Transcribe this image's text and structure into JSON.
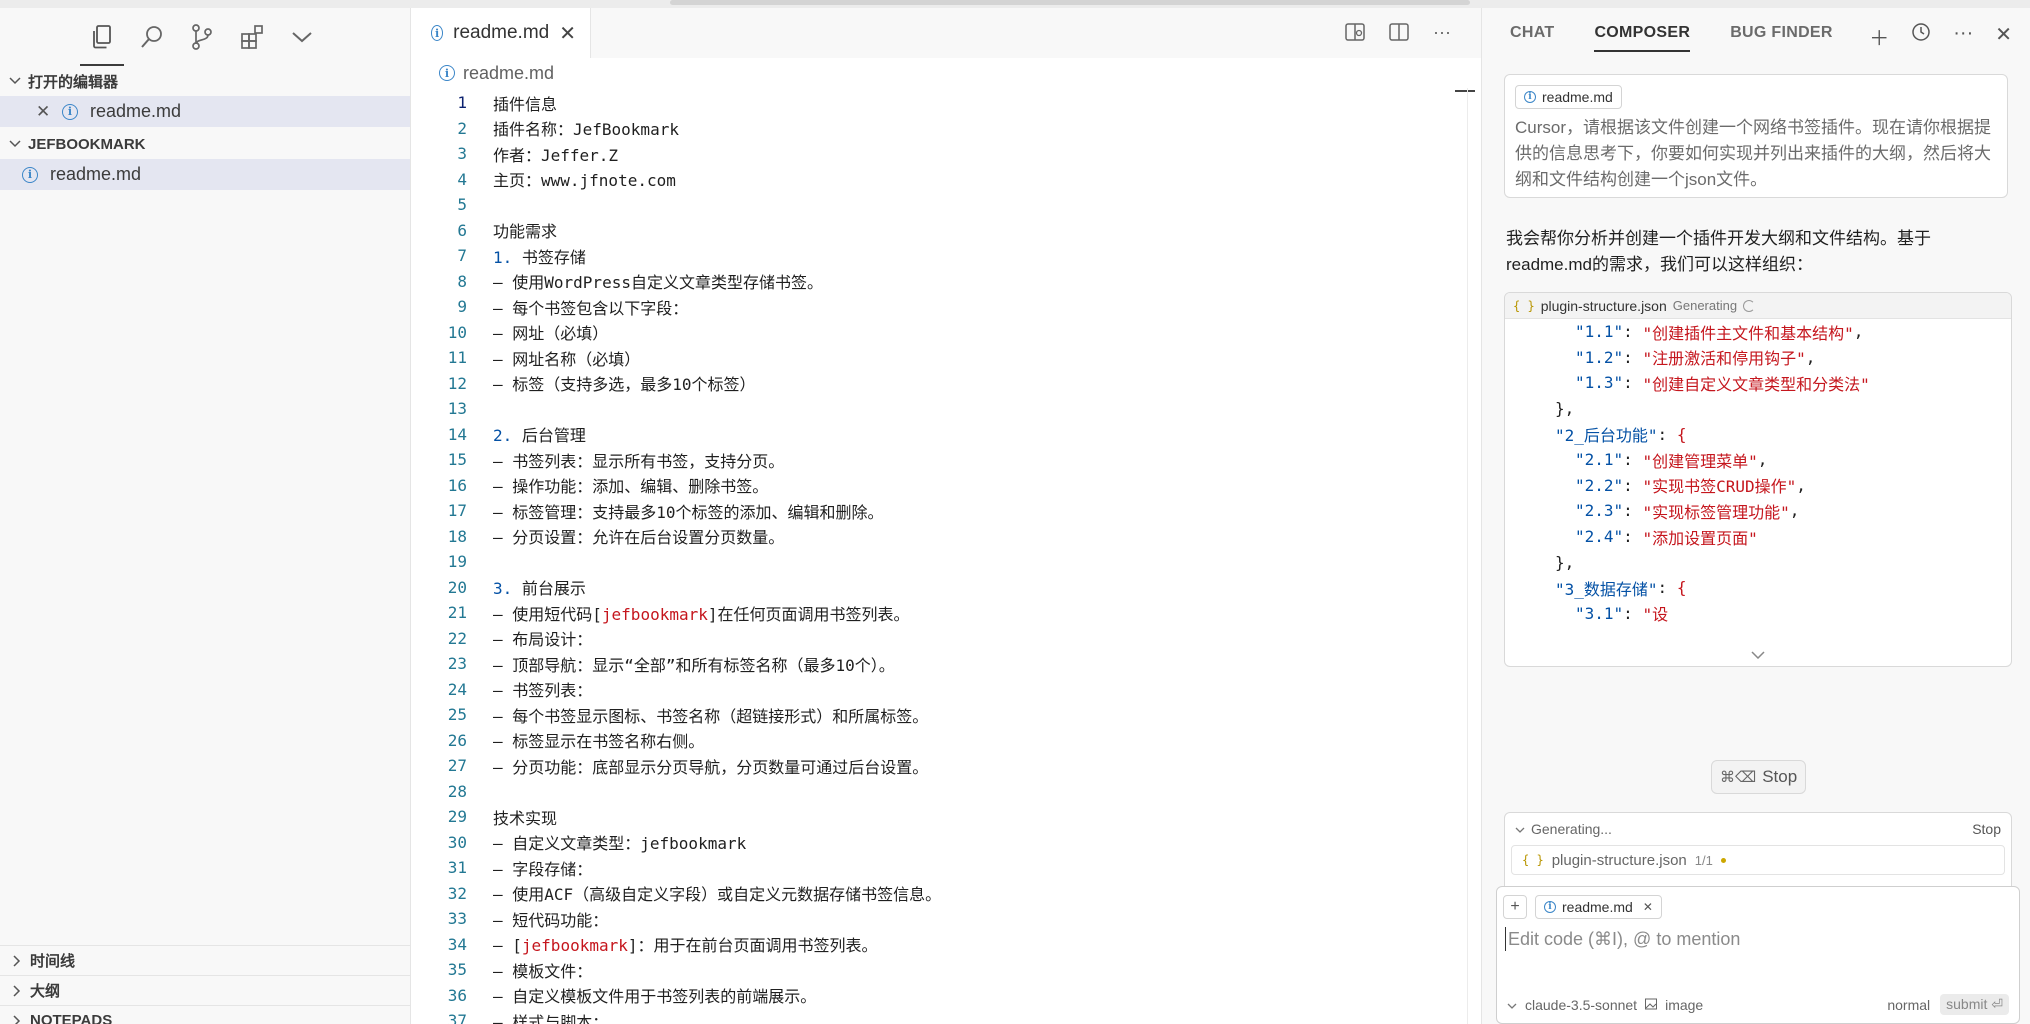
{
  "sidebar": {
    "open_editors_title": "打开的编辑器",
    "open_editor_file": "readme.md",
    "project_title": "JEFBOOKMARK",
    "project_file": "readme.md",
    "bottom_sections": [
      "时间线",
      "大纲",
      "NOTEPADS"
    ]
  },
  "editor": {
    "tab_label": "readme.md",
    "breadcrumb": "readme.md",
    "lines": [
      {
        "n": "1",
        "t": "插件信息"
      },
      {
        "n": "2",
        "t": "插件名称：JefBookmark"
      },
      {
        "n": "3",
        "t": "作者：Jeffer.Z"
      },
      {
        "n": "4",
        "t": "主页：www.jfnote.com"
      },
      {
        "n": "5",
        "t": ""
      },
      {
        "n": "6",
        "t": "功能需求"
      },
      {
        "n": "7",
        "p": "1.",
        "t": " 书签存储"
      },
      {
        "n": "8",
        "t": "– 使用WordPress自定义文章类型存储书签。"
      },
      {
        "n": "9",
        "t": "– 每个书签包含以下字段："
      },
      {
        "n": "10",
        "t": "– 网址（必填）"
      },
      {
        "n": "11",
        "t": "– 网址名称（必填）"
      },
      {
        "n": "12",
        "t": "– 标签（支持多选，最多10个标签）"
      },
      {
        "n": "13",
        "t": ""
      },
      {
        "n": "14",
        "p": "2.",
        "t": " 后台管理"
      },
      {
        "n": "15",
        "t": "– 书签列表：显示所有书签，支持分页。"
      },
      {
        "n": "16",
        "t": "– 操作功能：添加、编辑、删除书签。"
      },
      {
        "n": "17",
        "t": "– 标签管理：支持最多10个标签的添加、编辑和删除。"
      },
      {
        "n": "18",
        "t": "– 分页设置：允许在后台设置分页数量。"
      },
      {
        "n": "19",
        "t": ""
      },
      {
        "n": "20",
        "p": "3.",
        "t": " 前台展示"
      },
      {
        "n": "21",
        "t": "– 使用短代码[",
        "k": "jefbookmark",
        "t2": "]在任何页面调用书签列表。"
      },
      {
        "n": "22",
        "t": "– 布局设计："
      },
      {
        "n": "23",
        "t": "– 顶部导航：显示“全部”和所有标签名称（最多10个）。"
      },
      {
        "n": "24",
        "t": "– 书签列表："
      },
      {
        "n": "25",
        "t": "– 每个书签显示图标、书签名称（超链接形式）和所属标签。"
      },
      {
        "n": "26",
        "t": "– 标签显示在书签名称右侧。"
      },
      {
        "n": "27",
        "t": "– 分页功能：底部显示分页导航，分页数量可通过后台设置。"
      },
      {
        "n": "28",
        "t": ""
      },
      {
        "n": "29",
        "t": "技术实现"
      },
      {
        "n": "30",
        "t": "– 自定义文章类型：jefbookmark"
      },
      {
        "n": "31",
        "t": "– 字段存储："
      },
      {
        "n": "32",
        "t": "– 使用ACF（高级自定义字段）或自定义元数据存储书签信息。"
      },
      {
        "n": "33",
        "t": "– 短代码功能："
      },
      {
        "n": "34",
        "t": "– [",
        "k": "jefbookmark",
        "t2": "]：用于在前台页面调用书签列表。"
      },
      {
        "n": "35",
        "t": "– 模板文件："
      },
      {
        "n": "36",
        "t": "– 自定义模板文件用于书签列表的前端展示。"
      },
      {
        "n": "37",
        "t": "– 样式与脚本："
      }
    ]
  },
  "panel": {
    "tabs": [
      "CHAT",
      "COMPOSER",
      "BUG FINDER"
    ],
    "user_chip": "readme.md",
    "user_message": "Cursor，请根据该文件创建一个网络书签插件。现在请你根据提供的信息思考下，你要如何实现并列出来插件的大纲，然后将大纲和文件结构创建一个json文件。",
    "reply": "我会帮你分析并创建一个插件开发大纲和文件结构。基于readme.md的需求，我们可以这样组织：",
    "codeblock": {
      "file": "plugin-structure.json",
      "status": "Generating",
      "lines": [
        {
          "indent": "    ",
          "key": "\"1.1\"",
          "val": "\"创建插件主文件和基本结构\"",
          "end": ","
        },
        {
          "indent": "    ",
          "key": "\"1.2\"",
          "val": "\"注册激活和停用钩子\"",
          "end": ","
        },
        {
          "indent": "    ",
          "key": "\"1.3\"",
          "val": "\"创建自定义文章类型和分类法\"",
          "end": ""
        },
        {
          "indent": "  ",
          "plain": "},"
        },
        {
          "indent": "  ",
          "key": "\"2_后台功能\"",
          "brace": "{"
        },
        {
          "indent": "    ",
          "key": "\"2.1\"",
          "val": "\"创建管理菜单\"",
          "end": ","
        },
        {
          "indent": "    ",
          "key": "\"2.2\"",
          "val": "\"实现书签CRUD操作\"",
          "end": ","
        },
        {
          "indent": "    ",
          "key": "\"2.3\"",
          "val": "\"实现标签管理功能\"",
          "end": ","
        },
        {
          "indent": "    ",
          "key": "\"2.4\"",
          "val": "\"添加设置页面\"",
          "end": ""
        },
        {
          "indent": "  ",
          "plain": "},"
        },
        {
          "indent": "  ",
          "key": "\"3_数据存储\"",
          "brace": "{"
        },
        {
          "indent": "    ",
          "key": "\"3.1\"",
          "val": "\"设",
          "end": ""
        }
      ]
    },
    "stop_shortcut": "⌘⌫",
    "stop_label": "Stop",
    "generating_label": "Generating...",
    "generating_stop": "Stop",
    "gen_file": "plugin-structure.json",
    "gen_count": "1/1",
    "input_chip": "readme.md",
    "input_placeholder": "Edit code (⌘I), @ to mention",
    "model": "claude-3.5-sonnet",
    "image_label": "image",
    "mode": "normal",
    "submit": "submit ⏎"
  }
}
